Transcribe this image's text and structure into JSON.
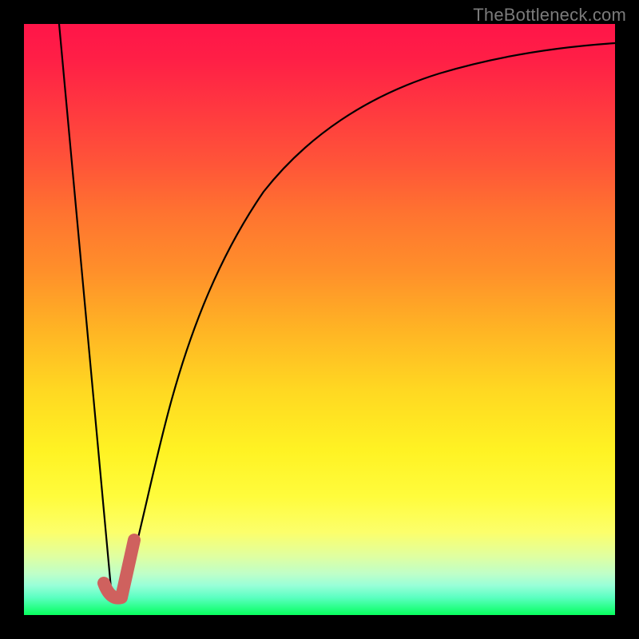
{
  "watermark": {
    "text": "TheBottleneck.com"
  },
  "chart_data": {
    "type": "line",
    "title": "",
    "xlabel": "",
    "ylabel": "",
    "ylim": [
      0,
      100
    ],
    "xlim": [
      0,
      100
    ],
    "x": [
      0,
      2,
      4,
      6,
      8,
      10,
      12,
      14,
      15,
      16,
      17,
      18,
      20,
      22,
      25,
      28,
      32,
      36,
      40,
      45,
      50,
      55,
      60,
      65,
      70,
      75,
      80,
      85,
      90,
      95,
      100
    ],
    "values": [
      100,
      87,
      74,
      61,
      48,
      35,
      22,
      9,
      3,
      0,
      0.5,
      4,
      14,
      26,
      40,
      51,
      61,
      68,
      73,
      78,
      82,
      85,
      87.5,
      89.5,
      91,
      92.2,
      93.2,
      94,
      94.6,
      95.1,
      95.5
    ],
    "marker": {
      "x_range": [
        13.5,
        18
      ],
      "y_range": [
        0,
        12
      ],
      "shape": "tick"
    },
    "colors": {
      "curve": "#000000",
      "marker": "#cf615e"
    }
  }
}
